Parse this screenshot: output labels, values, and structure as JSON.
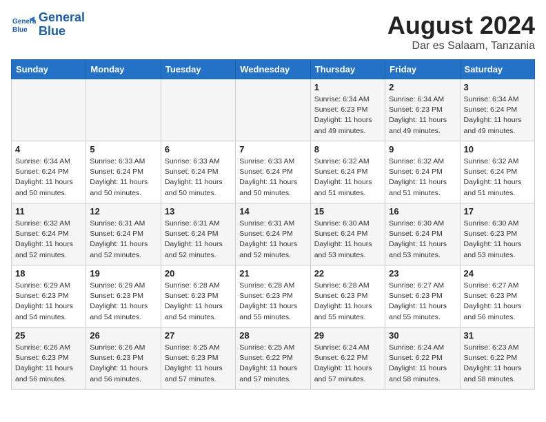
{
  "header": {
    "logo_line1": "General",
    "logo_line2": "Blue",
    "month_title": "August 2024",
    "location": "Dar es Salaam, Tanzania"
  },
  "days_of_week": [
    "Sunday",
    "Monday",
    "Tuesday",
    "Wednesday",
    "Thursday",
    "Friday",
    "Saturday"
  ],
  "weeks": [
    [
      {
        "day": "",
        "info": ""
      },
      {
        "day": "",
        "info": ""
      },
      {
        "day": "",
        "info": ""
      },
      {
        "day": "",
        "info": ""
      },
      {
        "day": "1",
        "info": "Sunrise: 6:34 AM\nSunset: 6:23 PM\nDaylight: 11 hours\nand 49 minutes."
      },
      {
        "day": "2",
        "info": "Sunrise: 6:34 AM\nSunset: 6:23 PM\nDaylight: 11 hours\nand 49 minutes."
      },
      {
        "day": "3",
        "info": "Sunrise: 6:34 AM\nSunset: 6:24 PM\nDaylight: 11 hours\nand 49 minutes."
      }
    ],
    [
      {
        "day": "4",
        "info": "Sunrise: 6:34 AM\nSunset: 6:24 PM\nDaylight: 11 hours\nand 50 minutes."
      },
      {
        "day": "5",
        "info": "Sunrise: 6:33 AM\nSunset: 6:24 PM\nDaylight: 11 hours\nand 50 minutes."
      },
      {
        "day": "6",
        "info": "Sunrise: 6:33 AM\nSunset: 6:24 PM\nDaylight: 11 hours\nand 50 minutes."
      },
      {
        "day": "7",
        "info": "Sunrise: 6:33 AM\nSunset: 6:24 PM\nDaylight: 11 hours\nand 50 minutes."
      },
      {
        "day": "8",
        "info": "Sunrise: 6:32 AM\nSunset: 6:24 PM\nDaylight: 11 hours\nand 51 minutes."
      },
      {
        "day": "9",
        "info": "Sunrise: 6:32 AM\nSunset: 6:24 PM\nDaylight: 11 hours\nand 51 minutes."
      },
      {
        "day": "10",
        "info": "Sunrise: 6:32 AM\nSunset: 6:24 PM\nDaylight: 11 hours\nand 51 minutes."
      }
    ],
    [
      {
        "day": "11",
        "info": "Sunrise: 6:32 AM\nSunset: 6:24 PM\nDaylight: 11 hours\nand 52 minutes."
      },
      {
        "day": "12",
        "info": "Sunrise: 6:31 AM\nSunset: 6:24 PM\nDaylight: 11 hours\nand 52 minutes."
      },
      {
        "day": "13",
        "info": "Sunrise: 6:31 AM\nSunset: 6:24 PM\nDaylight: 11 hours\nand 52 minutes."
      },
      {
        "day": "14",
        "info": "Sunrise: 6:31 AM\nSunset: 6:24 PM\nDaylight: 11 hours\nand 52 minutes."
      },
      {
        "day": "15",
        "info": "Sunrise: 6:30 AM\nSunset: 6:24 PM\nDaylight: 11 hours\nand 53 minutes."
      },
      {
        "day": "16",
        "info": "Sunrise: 6:30 AM\nSunset: 6:24 PM\nDaylight: 11 hours\nand 53 minutes."
      },
      {
        "day": "17",
        "info": "Sunrise: 6:30 AM\nSunset: 6:23 PM\nDaylight: 11 hours\nand 53 minutes."
      }
    ],
    [
      {
        "day": "18",
        "info": "Sunrise: 6:29 AM\nSunset: 6:23 PM\nDaylight: 11 hours\nand 54 minutes."
      },
      {
        "day": "19",
        "info": "Sunrise: 6:29 AM\nSunset: 6:23 PM\nDaylight: 11 hours\nand 54 minutes."
      },
      {
        "day": "20",
        "info": "Sunrise: 6:28 AM\nSunset: 6:23 PM\nDaylight: 11 hours\nand 54 minutes."
      },
      {
        "day": "21",
        "info": "Sunrise: 6:28 AM\nSunset: 6:23 PM\nDaylight: 11 hours\nand 55 minutes."
      },
      {
        "day": "22",
        "info": "Sunrise: 6:28 AM\nSunset: 6:23 PM\nDaylight: 11 hours\nand 55 minutes."
      },
      {
        "day": "23",
        "info": "Sunrise: 6:27 AM\nSunset: 6:23 PM\nDaylight: 11 hours\nand 55 minutes."
      },
      {
        "day": "24",
        "info": "Sunrise: 6:27 AM\nSunset: 6:23 PM\nDaylight: 11 hours\nand 56 minutes."
      }
    ],
    [
      {
        "day": "25",
        "info": "Sunrise: 6:26 AM\nSunset: 6:23 PM\nDaylight: 11 hours\nand 56 minutes."
      },
      {
        "day": "26",
        "info": "Sunrise: 6:26 AM\nSunset: 6:23 PM\nDaylight: 11 hours\nand 56 minutes."
      },
      {
        "day": "27",
        "info": "Sunrise: 6:25 AM\nSunset: 6:23 PM\nDaylight: 11 hours\nand 57 minutes."
      },
      {
        "day": "28",
        "info": "Sunrise: 6:25 AM\nSunset: 6:22 PM\nDaylight: 11 hours\nand 57 minutes."
      },
      {
        "day": "29",
        "info": "Sunrise: 6:24 AM\nSunset: 6:22 PM\nDaylight: 11 hours\nand 57 minutes."
      },
      {
        "day": "30",
        "info": "Sunrise: 6:24 AM\nSunset: 6:22 PM\nDaylight: 11 hours\nand 58 minutes."
      },
      {
        "day": "31",
        "info": "Sunrise: 6:23 AM\nSunset: 6:22 PM\nDaylight: 11 hours\nand 58 minutes."
      }
    ]
  ]
}
